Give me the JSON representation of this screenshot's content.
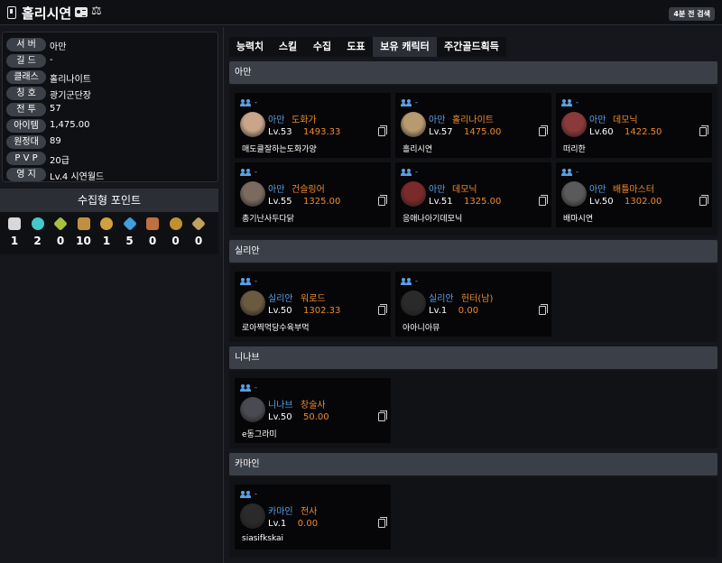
{
  "header": {
    "title": "홀리시연",
    "search_badge": "4분 전 검색"
  },
  "profile": [
    {
      "label": "서 버",
      "value": "아만"
    },
    {
      "label": "길 드",
      "value": "-"
    },
    {
      "label": "클래스",
      "value": "홀리나이트"
    },
    {
      "label": "칭 호",
      "value": "광기군단장"
    },
    {
      "label": "전 투",
      "value": "57"
    },
    {
      "label": "아이템",
      "value": "1,475.00"
    },
    {
      "label": "원정대",
      "value": "89"
    },
    {
      "label": "P V P",
      "value": "20급"
    },
    {
      "label": "영 지",
      "value": "Lv.4 시연월드"
    }
  ],
  "collection": {
    "title": "수집형 포인트",
    "items": [
      {
        "icon": "mokoko-seed-icon",
        "count": "1",
        "color": "#d8d8d8"
      },
      {
        "icon": "island-heart-icon",
        "count": "2",
        "color": "#46c8c8"
      },
      {
        "icon": "giant-heart-icon",
        "count": "0",
        "color": "#a8c040"
      },
      {
        "icon": "great-painting-icon",
        "count": "10",
        "color": "#c09040"
      },
      {
        "icon": "omnium-star-icon",
        "count": "1",
        "color": "#d0a040"
      },
      {
        "icon": "world-tree-leaf-icon",
        "count": "5",
        "color": "#40a0e0"
      },
      {
        "icon": "ignea-token-icon",
        "count": "0",
        "color": "#c07040"
      },
      {
        "icon": "sea-bounty-icon",
        "count": "0",
        "color": "#c09030"
      },
      {
        "icon": "orpheus-star-icon",
        "count": "0",
        "color": "#c0a060"
      }
    ]
  },
  "tabs": [
    {
      "label": "능력치",
      "active": false
    },
    {
      "label": "스킬",
      "active": false
    },
    {
      "label": "수집",
      "active": false
    },
    {
      "label": "도표",
      "active": false
    },
    {
      "label": "보유 캐릭터",
      "active": true
    },
    {
      "label": "주간골드획득",
      "active": false
    }
  ],
  "servers": [
    {
      "name": "아만",
      "characters": [
        {
          "group": "-",
          "server": "아만",
          "class": "도화가",
          "level": "Lv.53",
          "item_level": "1493.33",
          "name": "매도클잘하는도화가양",
          "avatar_color": "#c9a58a"
        },
        {
          "group": "-",
          "server": "아만",
          "class": "홀리나이트",
          "level": "Lv.57",
          "item_level": "1475.00",
          "name": "홀리시연",
          "avatar_color": "#b89a70"
        },
        {
          "group": "-",
          "server": "아만",
          "class": "데모닉",
          "level": "Lv.60",
          "item_level": "1422.50",
          "name": "떠리한",
          "avatar_color": "#8a3a3a"
        },
        {
          "group": "-",
          "server": "아만",
          "class": "건슬링어",
          "level": "Lv.55",
          "item_level": "1325.00",
          "name": "총기난사두다닭",
          "avatar_color": "#7a6a60"
        },
        {
          "group": "-",
          "server": "아만",
          "class": "데모닉",
          "level": "Lv.51",
          "item_level": "1325.00",
          "name": "응애나아기데모닉",
          "avatar_color": "#7a2a2a"
        },
        {
          "group": "-",
          "server": "아만",
          "class": "배틀마스터",
          "level": "Lv.50",
          "item_level": "1302.00",
          "name": "배마시연",
          "avatar_color": "#5a5a5a"
        }
      ]
    },
    {
      "name": "실리안",
      "characters": [
        {
          "group": "-",
          "server": "실리안",
          "class": "워로드",
          "level": "Lv.50",
          "item_level": "1302.33",
          "name": "로아찍먹당수육부먹",
          "avatar_color": "#6a5a40"
        },
        {
          "group": "-",
          "server": "실리안",
          "class": "헌터(남)",
          "level": "Lv.1",
          "item_level": "0.00",
          "name": "아아니아뮤",
          "avatar_color": "#2a2a2a"
        }
      ]
    },
    {
      "name": "니나브",
      "characters": [
        {
          "group": "-",
          "server": "니나브",
          "class": "창술사",
          "level": "Lv.50",
          "item_level": "50.00",
          "name": "e동그라미",
          "avatar_color": "#4a4a52"
        }
      ]
    },
    {
      "name": "카마인",
      "characters": [
        {
          "group": "-",
          "server": "카마인",
          "class": "전사",
          "level": "Lv.1",
          "item_level": "0.00",
          "name": "siasifkskai",
          "avatar_color": "#2a2a2a"
        }
      ]
    }
  ]
}
